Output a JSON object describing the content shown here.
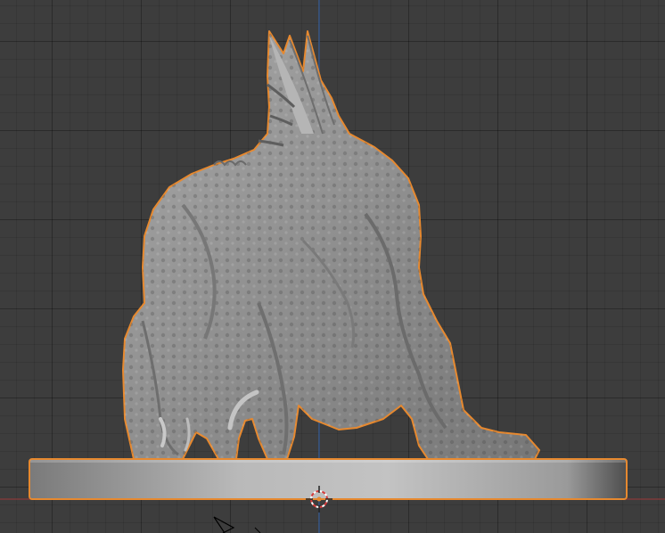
{
  "viewport": {
    "grid_color": "#3d3d3d",
    "axis_x_color": "#8a3b3b",
    "axis_z_color": "#3a5f95",
    "selection_color": "#e7892f",
    "model_color": "#9a9a9a"
  },
  "objects": {
    "creature": {
      "icon": "sculpted-creature-mesh",
      "selected": true
    },
    "base": {
      "icon": "round-base-mesh",
      "selected": true
    },
    "origin": {
      "icon": "3d-cursor-icon"
    },
    "camera": {
      "icon": "camera-icon"
    }
  }
}
